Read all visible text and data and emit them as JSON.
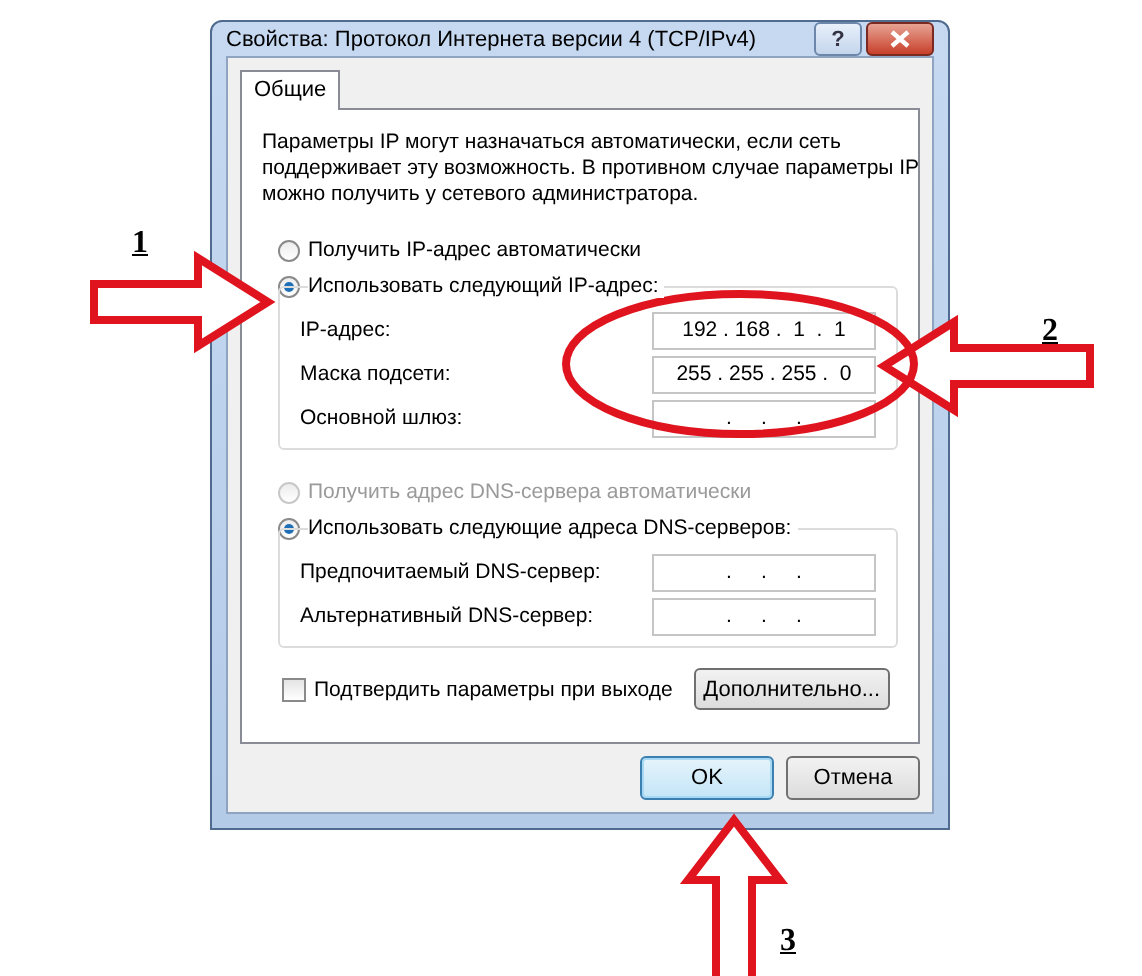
{
  "window": {
    "title": "Свойства: Протокол Интернета версии 4 (TCP/IPv4)",
    "help": "?"
  },
  "tabs": [
    {
      "label": "Общие",
      "selected": true
    }
  ],
  "description": "Параметры IP могут назначаться автоматически, если сеть поддерживает эту возможность. В противном случае параметры IP можно получить у сетевого администратора.",
  "ip_settings": {
    "options": [
      {
        "label": "Получить IP-адрес автоматически",
        "selected": false,
        "disabled": false
      },
      {
        "label": "Использовать следующий IP-адрес:",
        "selected": true,
        "disabled": false
      }
    ],
    "fields": [
      {
        "label": "IP-адрес:",
        "value": "192 . 168 .  1  .  1"
      },
      {
        "label": "Маска подсети:",
        "value": "255 . 255 . 255 .  0"
      },
      {
        "label": "Основной шлюз:",
        "value": ".     .     ."
      }
    ]
  },
  "dns_settings": {
    "options": [
      {
        "label": "Получить адрес DNS-сервера автоматически",
        "selected": false,
        "disabled": true
      },
      {
        "label": "Использовать следующие адреса DNS-серверов:",
        "selected": true,
        "disabled": false
      }
    ],
    "fields": [
      {
        "label": "Предпочитаемый DNS-сервер:",
        "value": ".     .     ."
      },
      {
        "label": "Альтернативный DNS-сервер:",
        "value": ".     .     ."
      }
    ]
  },
  "confirm_checkbox": {
    "label": "Подтвердить параметры при выходе",
    "checked": false
  },
  "advanced_button": "Дополнительно...",
  "buttons": [
    {
      "label": "OK",
      "default": true
    },
    {
      "label": "Отмена",
      "default": false
    }
  ],
  "annotations": [
    {
      "label": "1"
    },
    {
      "label": "2"
    },
    {
      "label": "3"
    }
  ]
}
